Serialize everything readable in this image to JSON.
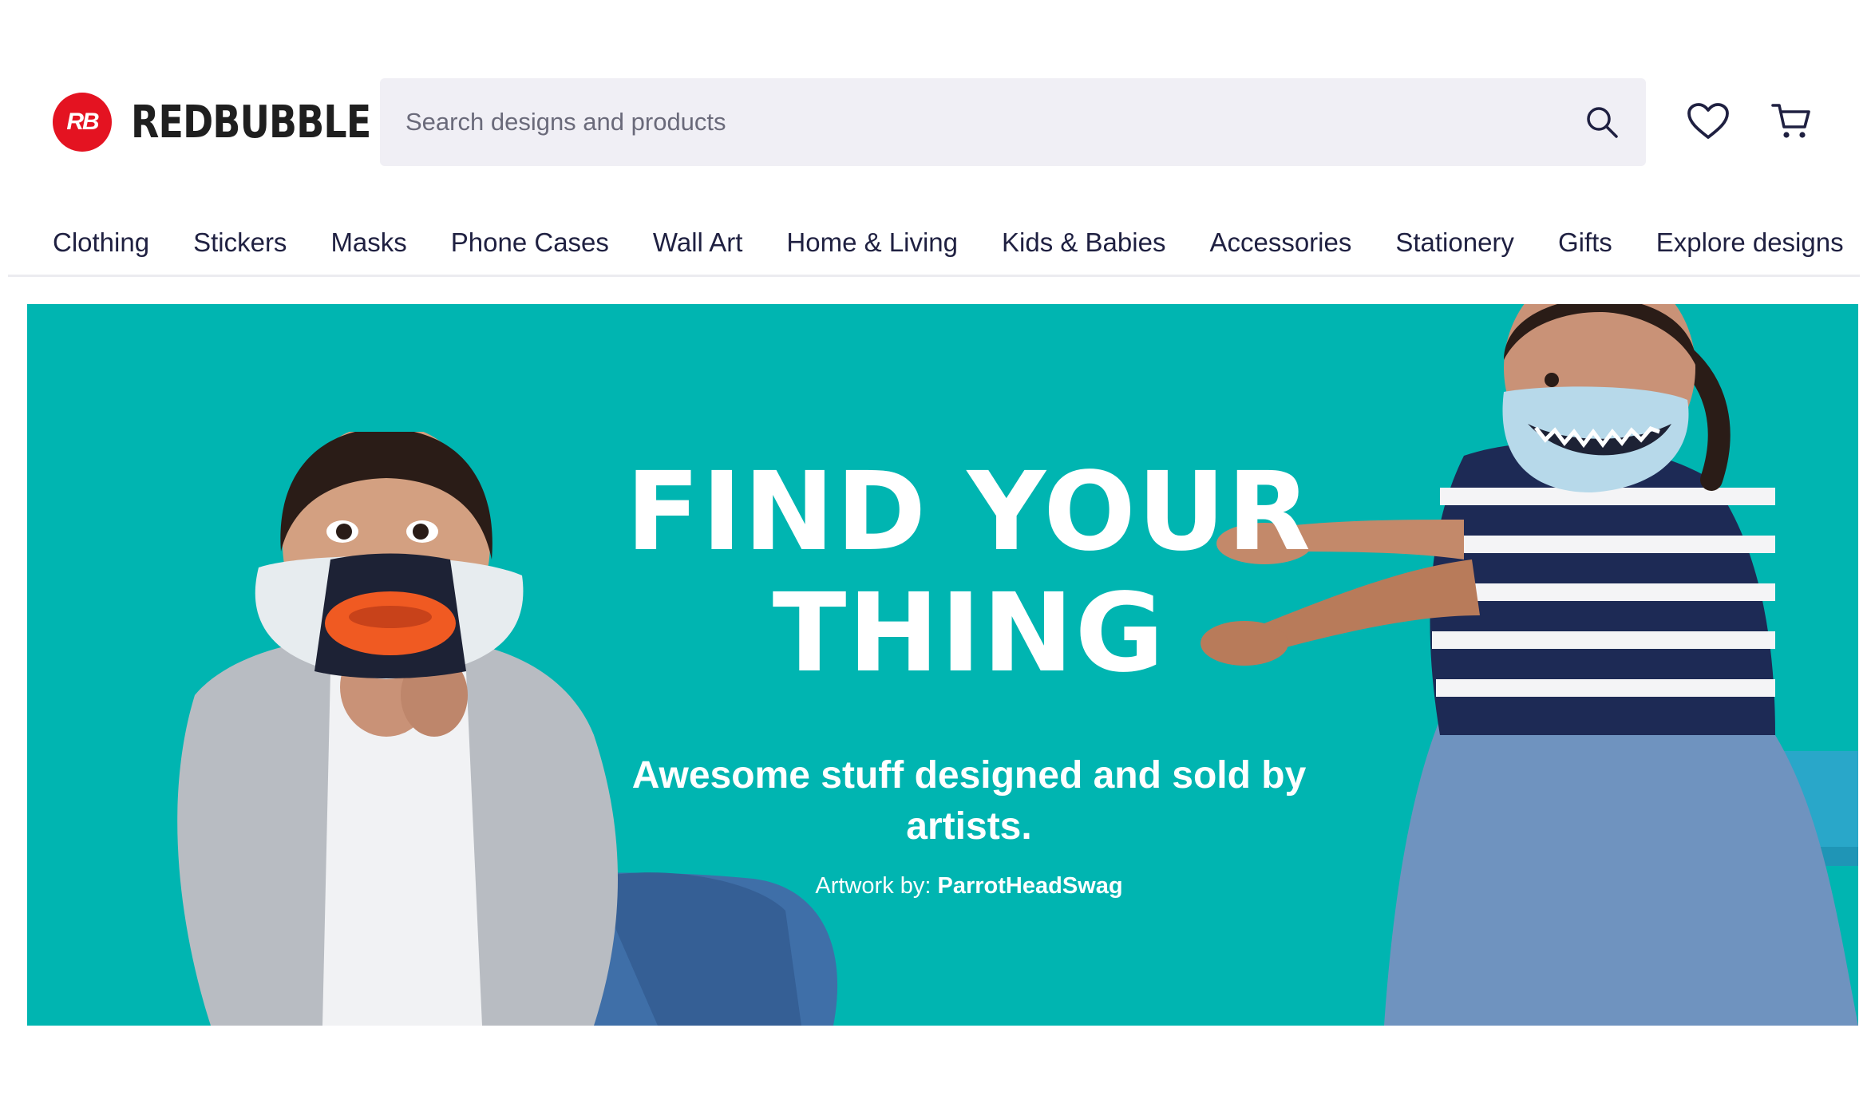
{
  "brand": {
    "name": "REDBUBBLE",
    "mark": "RB",
    "color": "#e41321"
  },
  "search": {
    "placeholder": "Search designs and products",
    "icon": "search-icon"
  },
  "header_icons": {
    "wishlist": "heart-icon",
    "cart": "cart-icon"
  },
  "nav": {
    "items": [
      "Clothing",
      "Stickers",
      "Masks",
      "Phone Cases",
      "Wall Art",
      "Home & Living",
      "Kids & Babies",
      "Accessories",
      "Stationery",
      "Gifts",
      "Explore designs"
    ]
  },
  "hero": {
    "headline_line1": "FIND YOUR",
    "headline_line2": "THING",
    "subhead": "Awesome stuff designed and sold by artists.",
    "credit_label": "Artwork by: ",
    "credit_artist": "ParrotHeadSwag",
    "background": "#00b5b1"
  }
}
